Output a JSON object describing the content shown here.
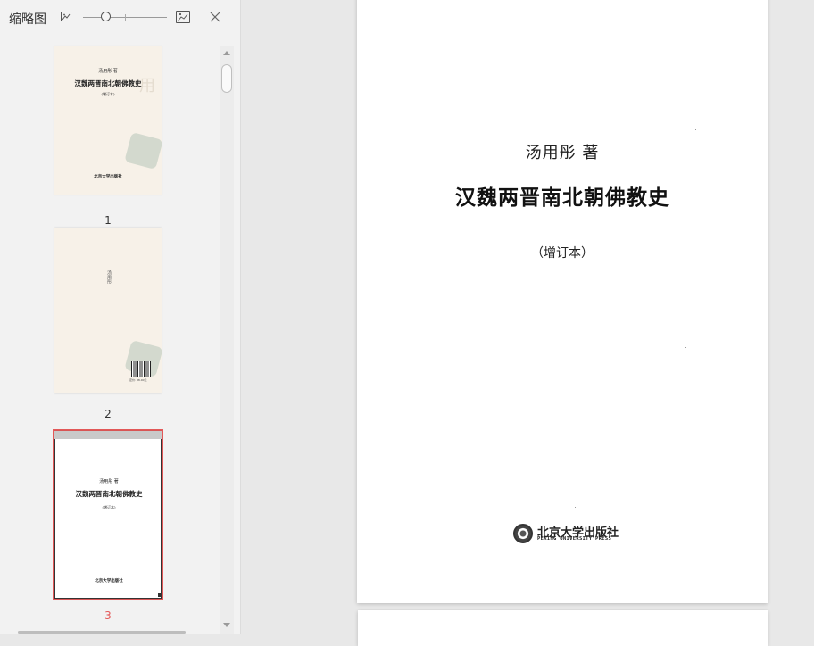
{
  "sidebar": {
    "title": "缩略图",
    "thumbnails": [
      {
        "number": "1",
        "author": "汤用彤 著",
        "title": "汉魏两晋南北朝佛教史",
        "edition": "(增订本)",
        "publisher": "北京大学出版社"
      },
      {
        "number": "2",
        "spine_text": "汤用彤",
        "barcode_text": "定价: 88.00元"
      },
      {
        "number": "3",
        "author": "汤用彤 著",
        "title": "汉魏两晋南北朝佛教史",
        "edition": "(增订本)",
        "publisher": "北京大学出版社"
      }
    ],
    "active_thumbnail": 3
  },
  "page": {
    "author": "汤用彤  著",
    "title": "汉魏两晋南北朝佛教史",
    "edition": "（增订本）",
    "publisher_cn": "北京大学出版社",
    "publisher_en": "PEKING UNIVERSITY PRESS"
  },
  "colors": {
    "active_border": "#e45a5a",
    "sidebar_bg": "#f2f2f2",
    "main_bg": "#e8e8e8"
  }
}
